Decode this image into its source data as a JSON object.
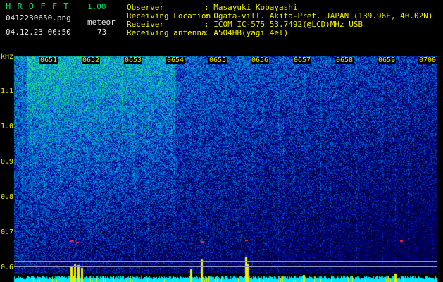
{
  "header": {
    "app_name": "H R O F F T",
    "version": "1.00",
    "filename": "0412230650.png",
    "mode_label": "meteor",
    "datetime": "04.12.23 06:50",
    "count": "73"
  },
  "info": {
    "observer_label": "Observer",
    "observer_value": ": Masayuki Kobayashi",
    "location_label": "Receiving Location",
    "location_value": ": Ogata-vill. Akita-Pref. JAPAN (139.96E, 40.02N)",
    "receiver_label": "Receiver",
    "receiver_value": ": ICOM IC-575 53.7492(@LCD)MHz USB",
    "antenna_label": "Receiving antenna",
    "antenna_value": ": A504HB(yagi 4el)"
  },
  "axis": {
    "unit": "kHz",
    "y_ticks": [
      "1.1",
      "1.0",
      "0.9",
      "0.8",
      "0.7",
      "0.6"
    ],
    "x_ticks": [
      "0651",
      "0652",
      "0653",
      "0654",
      "0655",
      "0656",
      "0657",
      "0658",
      "0659",
      "0700"
    ]
  },
  "colors": {
    "background": "#000000",
    "header_green": "#00e060",
    "label_yellow": "#f0f000",
    "spectrum_low": "#000050",
    "spectrum_mid": "#0060ff",
    "spectrum_high": "#00ff80",
    "level_bar": "#00e8ff"
  }
}
